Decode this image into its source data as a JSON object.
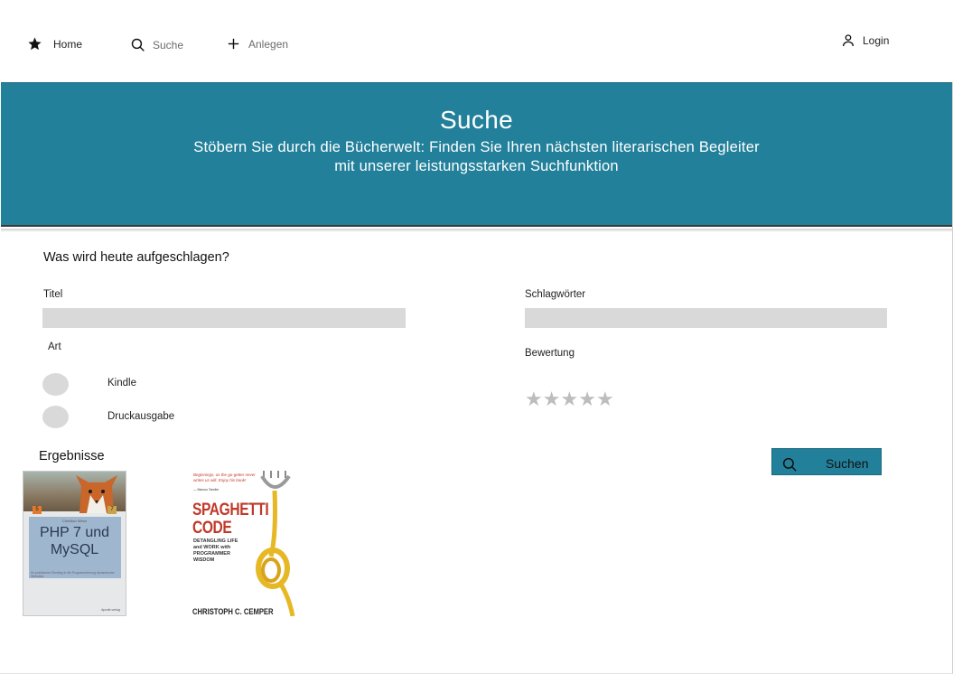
{
  "nav": {
    "home": "Home",
    "search": "Suche",
    "create": "Anlegen",
    "login": "Login"
  },
  "hero": {
    "title": "Suche",
    "subtitle": "Stöbern Sie durch die Bücherwelt: Finden Sie Ihren nächsten literarischen Begleiter mit unserer leistungsstarken Suchfunktion",
    "color": "#22809a"
  },
  "form": {
    "title": "Was wird heute aufgeschlagen?",
    "title_label": "Titel",
    "title_value": "",
    "keywords_label": "Schlagwörter",
    "keywords_value": "",
    "type_label": "Art",
    "type_options": [
      "Kindle",
      "Druckausgabe"
    ],
    "rating_label": "Bewertung",
    "rating_value": 0,
    "rating_max": 5,
    "search_button": "Suchen"
  },
  "results": {
    "title": "Ergebnisse",
    "books": [
      {
        "cover_title_line1": "PHP 7 und",
        "cover_title_line2": "MySQL",
        "cover_author": "Christian Wenz",
        "cover_subtitle": "Ihr praktischer Einstieg in die Programmierung dynamischer Websites",
        "cover_publisher": "dpunkt.verlag",
        "tag_left": "5",
        "tag_right": "7"
      },
      {
        "cover_quote": "Beginnings, as the go-getter never writes us will. Enjoy his book!",
        "cover_quote_author": "— Marcus Tandler",
        "cover_title_line1": "SPAGHETTI",
        "cover_title_line2": "CODE",
        "cover_subtitle_1": "DETANGLING LIFE",
        "cover_subtitle_2": "and WORK with",
        "cover_subtitle_3": "PROGRAMMER",
        "cover_subtitle_4": "WISDOM",
        "cover_author": "CHRISTOPH C. CEMPER"
      }
    ]
  }
}
